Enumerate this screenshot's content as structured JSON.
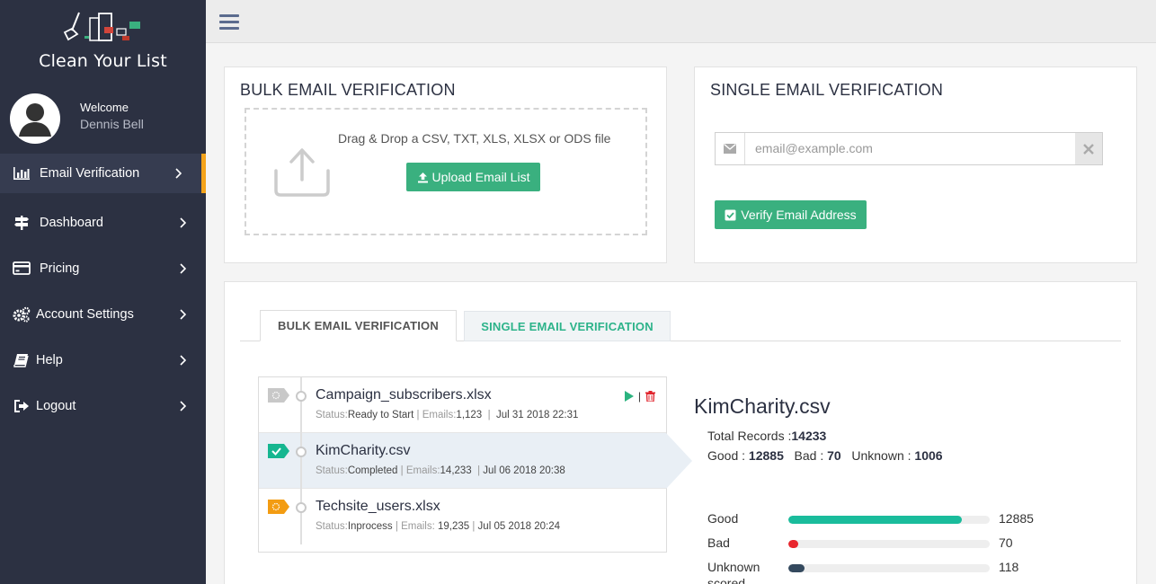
{
  "app": {
    "logo_text": "Clean Your List"
  },
  "profile": {
    "welcome": "Welcome",
    "name": "Dennis Bell"
  },
  "sidebar": {
    "items": [
      {
        "label": "Email Verification",
        "icon": "bar-chart-icon",
        "active": true
      },
      {
        "label": "Dashboard",
        "icon": "signpost-icon",
        "active": false
      },
      {
        "label": "Pricing",
        "icon": "credit-card-icon",
        "active": false
      },
      {
        "label": "Account Settings",
        "icon": "gears-icon",
        "active": false
      },
      {
        "label": "Help",
        "icon": "book-icon",
        "active": false
      },
      {
        "label": "Logout",
        "icon": "sign-out-icon",
        "active": false
      }
    ]
  },
  "bulk": {
    "title": "BULK EMAIL VERIFICATION",
    "drop_text": "Drag & Drop a CSV, TXT, XLS, XLSX or ODS file",
    "upload_label": "Upload Email List"
  },
  "single": {
    "title": "SINGLE EMAIL VERIFICATION",
    "placeholder": "email@example.com",
    "value": "",
    "verify_label": "Verify Email Address"
  },
  "tabs": [
    {
      "label": "BULK EMAIL VERIFICATION",
      "active": true
    },
    {
      "label": "SINGLE EMAIL VERIFICATION",
      "active": false
    }
  ],
  "files": [
    {
      "name": "Campaign_subscribers.xlsx",
      "status_label": "Status:",
      "status": "Ready to Start",
      "emails_label": "Emails:",
      "emails": "1,123",
      "date": "Jul 31 2018 22:31",
      "tag": "pending",
      "selected": false
    },
    {
      "name": "KimCharity.csv",
      "status_label": "Status:",
      "status": "Completed",
      "emails_label": "Emails:",
      "emails": "14,233",
      "date": "Jul 06 2018 20:38",
      "tag": "completed",
      "selected": true
    },
    {
      "name": "Techsite_users.xlsx",
      "status_label": "Status:",
      "status": "Inprocess",
      "emails_label": "Emails:",
      "emails": "19,235",
      "date": "Jul 05 2018 20:24",
      "tag": "inprocess",
      "selected": false
    }
  ],
  "detail": {
    "title": "KimCharity.csv",
    "total_label": "Total Records :",
    "total": "14233",
    "good_label": "Good :",
    "good": "12885",
    "bad_label": "Bad :",
    "bad": "70",
    "unknown_label": "Unknown :",
    "unknown": "1006",
    "bars": [
      {
        "label": "Good",
        "value": "12885",
        "fraction": 0.86,
        "color": "#1abc9c"
      },
      {
        "label": "Bad",
        "value": "70",
        "fraction": 0.05,
        "color": "#e8262d"
      },
      {
        "label": "Unknown",
        "value": "118",
        "fraction": 0.08,
        "color": "#34495e"
      }
    ],
    "cutoff_label": "scored"
  },
  "colors": {
    "sidebar_bg": "#2c3142",
    "accent_orange": "#f4a31b",
    "green_button": "#3ab07f",
    "teal_tab": "#2db38a"
  }
}
